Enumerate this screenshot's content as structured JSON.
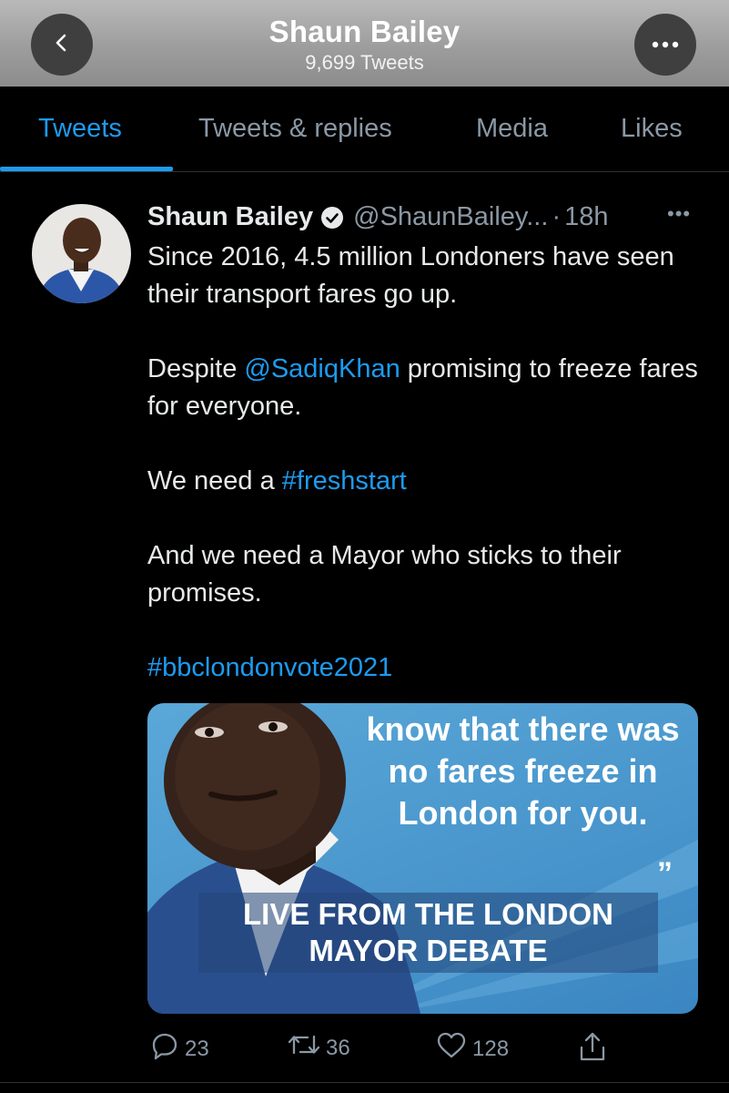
{
  "header": {
    "title": "Shaun Bailey",
    "subtitle": "9,699 Tweets",
    "back_icon": "chevron-left-icon",
    "more_icon": "ellipsis-icon"
  },
  "tabs": [
    {
      "label": "Tweets",
      "active": true
    },
    {
      "label": "Tweets & replies",
      "active": false
    },
    {
      "label": "Media",
      "active": false
    },
    {
      "label": "Likes",
      "active": false
    }
  ],
  "tweet": {
    "author": "Shaun Bailey",
    "handle": "@ShaunBailey...",
    "separator": "·",
    "time": "18h",
    "more": "•••",
    "verified_icon": "verified-badge-icon",
    "body": {
      "p1": "Since 2016, 4.5 million Londoners have seen their transport fares go up.",
      "p2_pre": "Despite ",
      "p2_mention": "@SadiqKhan",
      "p2_post": " promising to freeze fares for everyone.",
      "p3_pre": "We need a ",
      "p3_hashtag": "#freshstart",
      "p4": "And we need a Mayor who sticks to their promises.",
      "p5_hashtag": "#bbclondonvote2021"
    },
    "media": {
      "quote": "know that there was no fares freeze in London for you.",
      "quote_mark": "”",
      "banner_line1": "LIVE FROM THE LONDON",
      "banner_line2": "MAYOR DEBATE"
    },
    "actions": {
      "reply_count": "23",
      "retweet_count": "36",
      "like_count": "128"
    }
  },
  "colors": {
    "accent": "#1d9bf0",
    "muted": "#8b98a5",
    "background": "#000000"
  }
}
